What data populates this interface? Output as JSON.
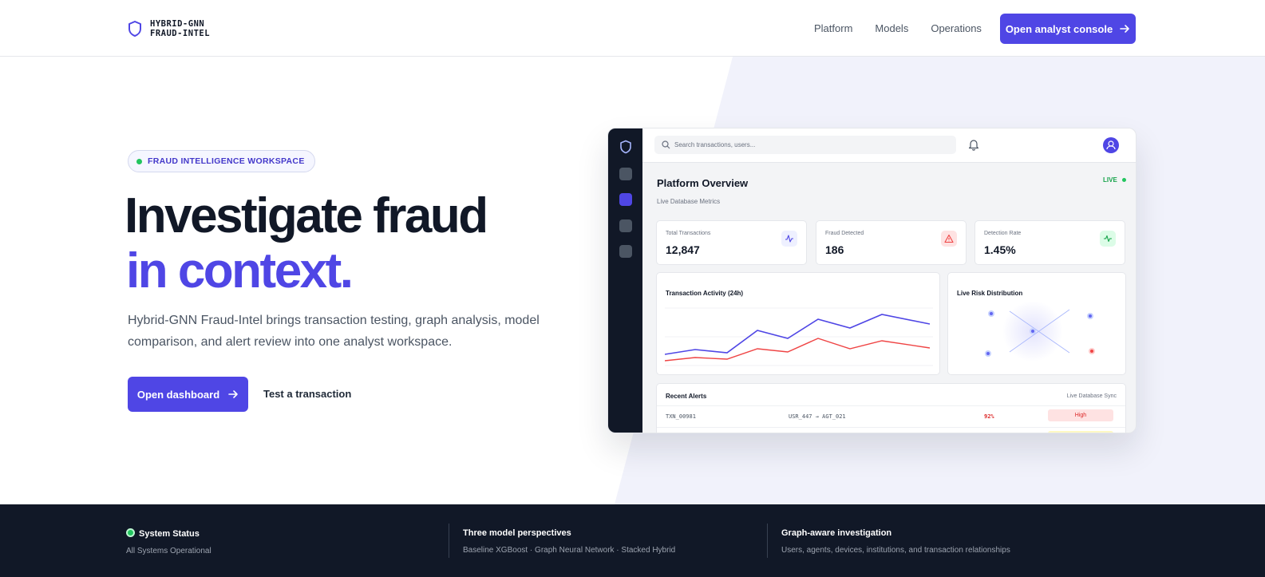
{
  "brand": {
    "line1": "HYBRID-GNN",
    "line2": "FRAUD-INTEL"
  },
  "nav": [
    "Platform",
    "Models",
    "Operations"
  ],
  "header_cta": "Open analyst console",
  "hero": {
    "badge": "FRAUD INTELLIGENCE WORKSPACE",
    "title_line1": "Investigate fraud",
    "title_line2": "in context.",
    "lede": "Hybrid-GNN Fraud-Intel brings transaction testing, graph analysis, model comparison, and alert review into one analyst workspace.",
    "primary_button": "Open dashboard",
    "secondary_link": "Test a transaction"
  },
  "mock": {
    "search_placeholder": "Search transactions, users...",
    "title": "Platform Overview",
    "subtitle": "Live Database Metrics",
    "live": "LIVE",
    "stats": [
      {
        "label": "Total Transactions",
        "value": "12,847",
        "icon": "activity-icon"
      },
      {
        "label": "Fraud Detected",
        "value": "186",
        "icon": "alert-triangle-icon"
      },
      {
        "label": "Detection Rate",
        "value": "1.45%",
        "icon": "pulse-icon"
      }
    ],
    "activity_title": "Transaction Activity (24h)",
    "risk_title": "Live Risk Distribution",
    "alerts_title": "Recent Alerts",
    "alerts_sync": "Live Database Sync",
    "alerts": [
      {
        "id": "TXN_00981",
        "route": "USR_447 → AGT_021",
        "score": "92%",
        "level": "High"
      }
    ],
    "colors": {
      "accent": "#4f46e5",
      "danger": "#ef4444",
      "success": "#22c55e"
    }
  },
  "footer": {
    "status_title": "System Status",
    "status_text": "All Systems Operational",
    "models_title": "Three model perspectives",
    "models_text": "Baseline XGBoost · Graph Neural Network · Stacked Hybrid",
    "graph_title": "Graph-aware investigation",
    "graph_text": "Users, agents, devices, institutions, and transaction relationships"
  }
}
